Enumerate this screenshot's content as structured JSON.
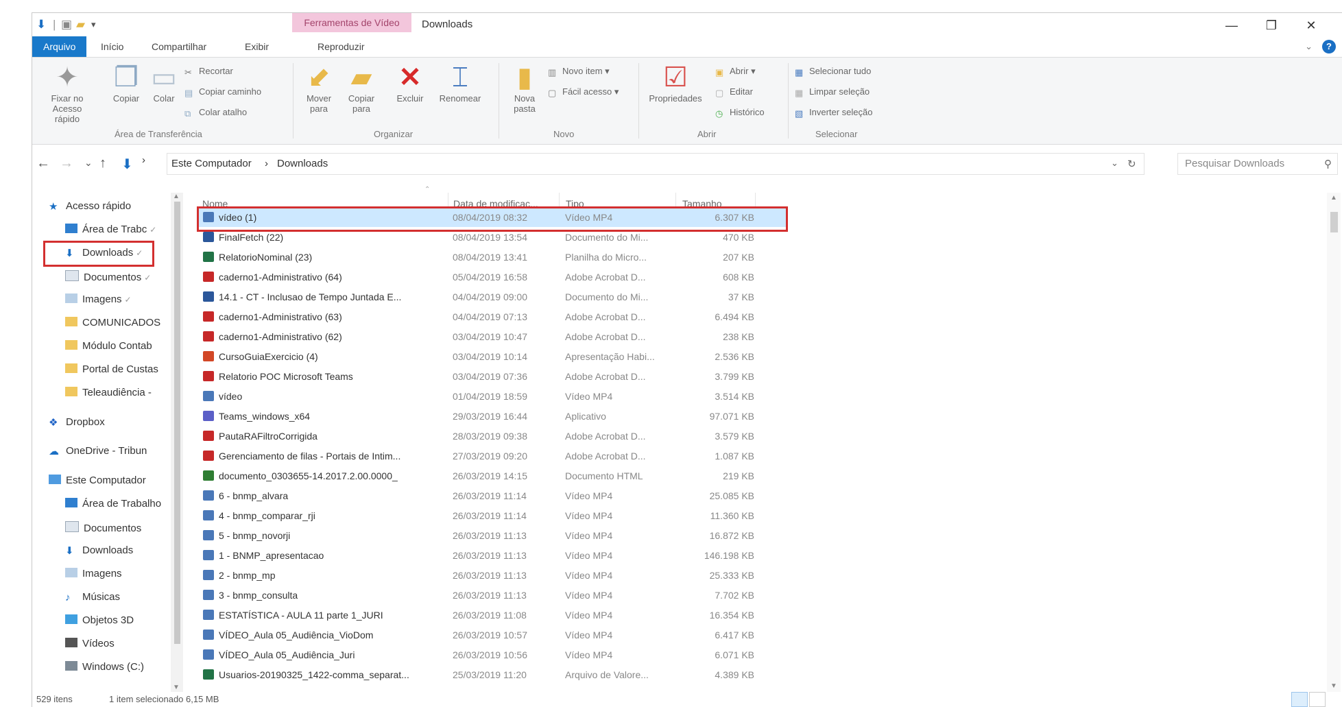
{
  "titlebar": {
    "context_tab": "Ferramentas de Vídeo",
    "title": "Downloads",
    "minimize": "—",
    "restore": "❐",
    "close": "✕"
  },
  "ribbon_tabs": {
    "file": "Arquivo",
    "home": "Início",
    "share": "Compartilhar",
    "view": "Exibir",
    "play": "Reproduzir",
    "help": "?"
  },
  "ribbon": {
    "pin_quick_access": "Fixar no Acesso rápido",
    "copy": "Copiar",
    "paste": "Colar",
    "cut": "Recortar",
    "copy_path": "Copiar caminho",
    "paste_shortcut": "Colar atalho",
    "clipboard_group": "Área de Transferência",
    "move_to": "Mover para",
    "copy_to": "Copiar para",
    "delete": "Excluir",
    "rename": "Renomear",
    "organize_group": "Organizar",
    "new_folder": "Nova pasta",
    "new_item": "Novo item",
    "easy_access": "Fácil acesso",
    "new_group": "Novo",
    "properties": "Propriedades",
    "open": "Abrir",
    "edit": "Editar",
    "history": "Histórico",
    "open_group": "Abrir",
    "select_all": "Selecionar tudo",
    "select_none": "Limpar seleção",
    "invert_selection": "Inverter seleção",
    "select_group": "Selecionar"
  },
  "address": {
    "back": "←",
    "forward": "→",
    "recent": "⌄",
    "up": "↑",
    "crumb_root": "Este Computador",
    "crumb_sep": "›",
    "crumb_current": "Downloads",
    "refresh": "↻",
    "search_placeholder": "Pesquisar Downloads"
  },
  "nav": {
    "quick_access": "Acesso rápido",
    "items": [
      {
        "label": "Área de Trabc",
        "pin": "✓"
      },
      {
        "label": "Downloads",
        "pin": "✓"
      },
      {
        "label": "Documentos",
        "pin": "✓"
      },
      {
        "label": "Imagens",
        "pin": "✓"
      },
      {
        "label": "COMUNICADOS"
      },
      {
        "label": "Módulo Contab"
      },
      {
        "label": "Portal de Custas"
      },
      {
        "label": "Teleaudiência -"
      }
    ],
    "dropbox": "Dropbox",
    "onedrive": "OneDrive - Tribun",
    "this_pc": "Este Computador",
    "pc_items": [
      {
        "label": "Área de Trabalho"
      },
      {
        "label": "Documentos"
      },
      {
        "label": "Downloads"
      },
      {
        "label": "Imagens"
      },
      {
        "label": "Músicas"
      },
      {
        "label": "Objetos 3D"
      },
      {
        "label": "Vídeos"
      },
      {
        "label": "Windows (C:)"
      }
    ]
  },
  "columns": {
    "name": "Nome",
    "date": "Data de modificaç...",
    "type": "Tipo",
    "size": "Tamanho"
  },
  "files": [
    {
      "name": "vídeo (1)",
      "date": "08/04/2019 08:32",
      "type": "Vídeo MP4",
      "size": "6.307 KB",
      "icon": "video",
      "selected": true
    },
    {
      "name": "FinalFetch (22)",
      "date": "08/04/2019 13:54",
      "type": "Documento do Mi...",
      "size": "470 KB",
      "icon": "word"
    },
    {
      "name": "RelatorioNominal (23)",
      "date": "08/04/2019 13:41",
      "type": "Planilha do Micro...",
      "size": "207 KB",
      "icon": "excel"
    },
    {
      "name": "caderno1-Administrativo (64)",
      "date": "05/04/2019 16:58",
      "type": "Adobe Acrobat D...",
      "size": "608 KB",
      "icon": "pdf"
    },
    {
      "name": "14.1 - CT - Inclusao de Tempo Juntada E...",
      "date": "04/04/2019 09:00",
      "type": "Documento do Mi...",
      "size": "37 KB",
      "icon": "word"
    },
    {
      "name": "caderno1-Administrativo (63)",
      "date": "04/04/2019 07:13",
      "type": "Adobe Acrobat D...",
      "size": "6.494 KB",
      "icon": "pdf"
    },
    {
      "name": "caderno1-Administrativo (62)",
      "date": "03/04/2019 10:47",
      "type": "Adobe Acrobat D...",
      "size": "238 KB",
      "icon": "pdf"
    },
    {
      "name": "CursoGuiaExercicio (4)",
      "date": "03/04/2019 10:14",
      "type": "Apresentação Habi...",
      "size": "2.536 KB",
      "icon": "ppt"
    },
    {
      "name": "Relatorio POC Microsoft Teams",
      "date": "03/04/2019 07:36",
      "type": "Adobe Acrobat D...",
      "size": "3.799 KB",
      "icon": "pdf"
    },
    {
      "name": "vídeo",
      "date": "01/04/2019 18:59",
      "type": "Vídeo MP4",
      "size": "3.514 KB",
      "icon": "video"
    },
    {
      "name": "Teams_windows_x64",
      "date": "29/03/2019 16:44",
      "type": "Aplicativo",
      "size": "97.071 KB",
      "icon": "app"
    },
    {
      "name": "PautaRAFiltroCorrigida",
      "date": "28/03/2019 09:38",
      "type": "Adobe Acrobat D...",
      "size": "3.579 KB",
      "icon": "pdf"
    },
    {
      "name": "Gerenciamento de filas - Portais de Intim...",
      "date": "27/03/2019 09:20",
      "type": "Adobe Acrobat D...",
      "size": "1.087 KB",
      "icon": "pdf"
    },
    {
      "name": "documento_0303655-14.2017.2.00.0000_",
      "date": "26/03/2019 14:15",
      "type": "Documento HTML",
      "size": "219 KB",
      "icon": "html"
    },
    {
      "name": "6 - bnmp_alvara",
      "date": "26/03/2019 11:14",
      "type": "Vídeo MP4",
      "size": "25.085 KB",
      "icon": "video"
    },
    {
      "name": "4 - bnmp_comparar_rji",
      "date": "26/03/2019 11:14",
      "type": "Vídeo MP4",
      "size": "11.360 KB",
      "icon": "video"
    },
    {
      "name": "5 - bnmp_novorji",
      "date": "26/03/2019 11:13",
      "type": "Vídeo MP4",
      "size": "16.872 KB",
      "icon": "video"
    },
    {
      "name": "1 - BNMP_apresentacao",
      "date": "26/03/2019 11:13",
      "type": "Vídeo MP4",
      "size": "146.198 KB",
      "icon": "video"
    },
    {
      "name": "2 - bnmp_mp",
      "date": "26/03/2019 11:13",
      "type": "Vídeo MP4",
      "size": "25.333 KB",
      "icon": "video"
    },
    {
      "name": "3 - bnmp_consulta",
      "date": "26/03/2019 11:13",
      "type": "Vídeo MP4",
      "size": "7.702 KB",
      "icon": "video"
    },
    {
      "name": "ESTATÍSTICA - AULA 11 parte 1_JURI",
      "date": "26/03/2019 11:08",
      "type": "Vídeo MP4",
      "size": "16.354 KB",
      "icon": "video"
    },
    {
      "name": "VÍDEO_Aula 05_Audiência_VioDom",
      "date": "26/03/2019 10:57",
      "type": "Vídeo MP4",
      "size": "6.417 KB",
      "icon": "video"
    },
    {
      "name": "VÍDEO_Aula 05_Audiência_Juri",
      "date": "26/03/2019 10:56",
      "type": "Vídeo MP4",
      "size": "6.071 KB",
      "icon": "video"
    },
    {
      "name": "Usuarios-20190325_1422-comma_separat...",
      "date": "25/03/2019 11:20",
      "type": "Arquivo de Valore...",
      "size": "4.389 KB",
      "icon": "excel"
    }
  ],
  "status": {
    "count": "529 itens",
    "selection": "1 item selecionado  6,15 MB"
  },
  "colors": {
    "accent": "#1979ca",
    "selection": "#cde8ff",
    "highlight_box": "#d32f2f",
    "context_tab": "#f3c6dc"
  }
}
